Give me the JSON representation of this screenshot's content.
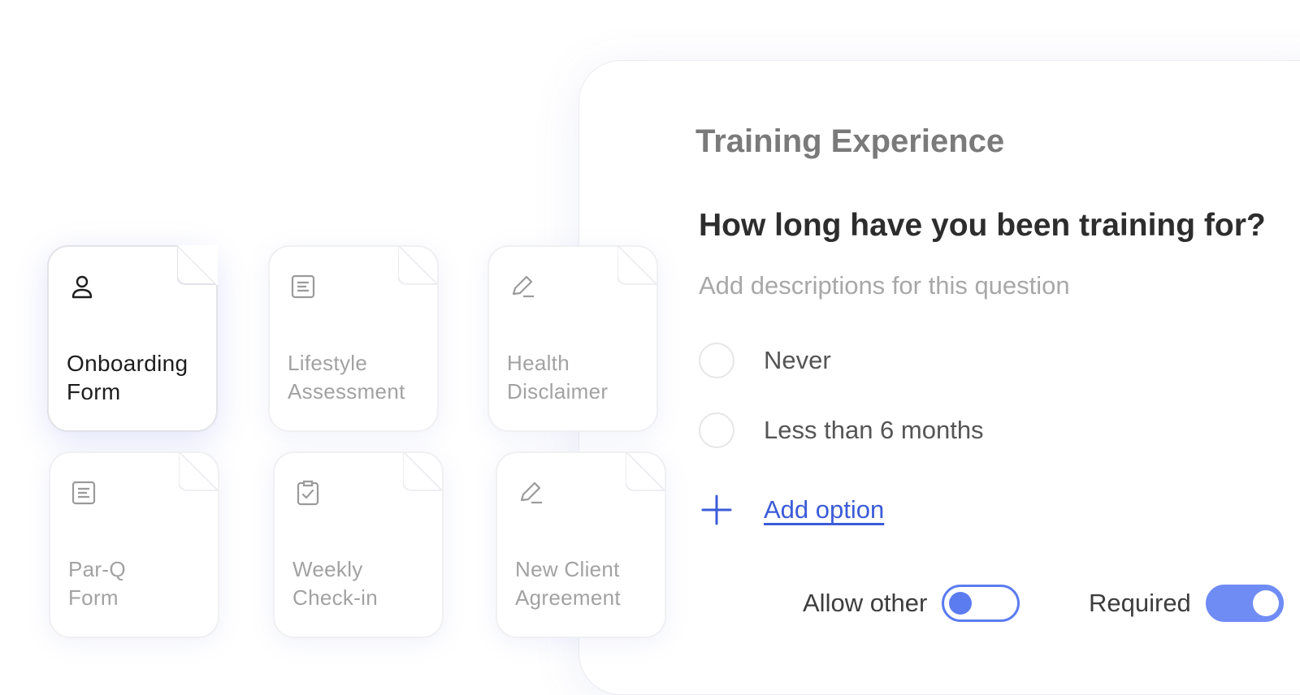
{
  "cards": [
    {
      "line1": "Onboarding",
      "line2": "Form",
      "icon": "user-icon",
      "active": true
    },
    {
      "line1": "Lifestyle",
      "line2": "Assessment",
      "icon": "document-icon",
      "active": false
    },
    {
      "line1": "Health",
      "line2": "Disclaimer",
      "icon": "pen-icon",
      "active": false
    },
    {
      "line1": "Par-Q",
      "line2": "Form",
      "icon": "document-icon",
      "active": false
    },
    {
      "line1": "Weekly",
      "line2": "Check-in",
      "icon": "clipboard-check-icon",
      "active": false
    },
    {
      "line1": "New Client",
      "line2": "Agreement",
      "icon": "pen-icon",
      "active": false
    }
  ],
  "editor": {
    "section_title": "Training Experience",
    "question": "How long have you been training for?",
    "description_placeholder": "Add descriptions for this question",
    "options": [
      "Never",
      "Less than 6 months"
    ],
    "add_option_label": "Add option",
    "allow_other_label": "Allow other",
    "allow_other_on": false,
    "required_label": "Required",
    "required_on": true
  },
  "colors": {
    "accent": "#3b5bd8",
    "toggle": "#5b7cf0",
    "toggle_on": "#6f8cf5"
  }
}
